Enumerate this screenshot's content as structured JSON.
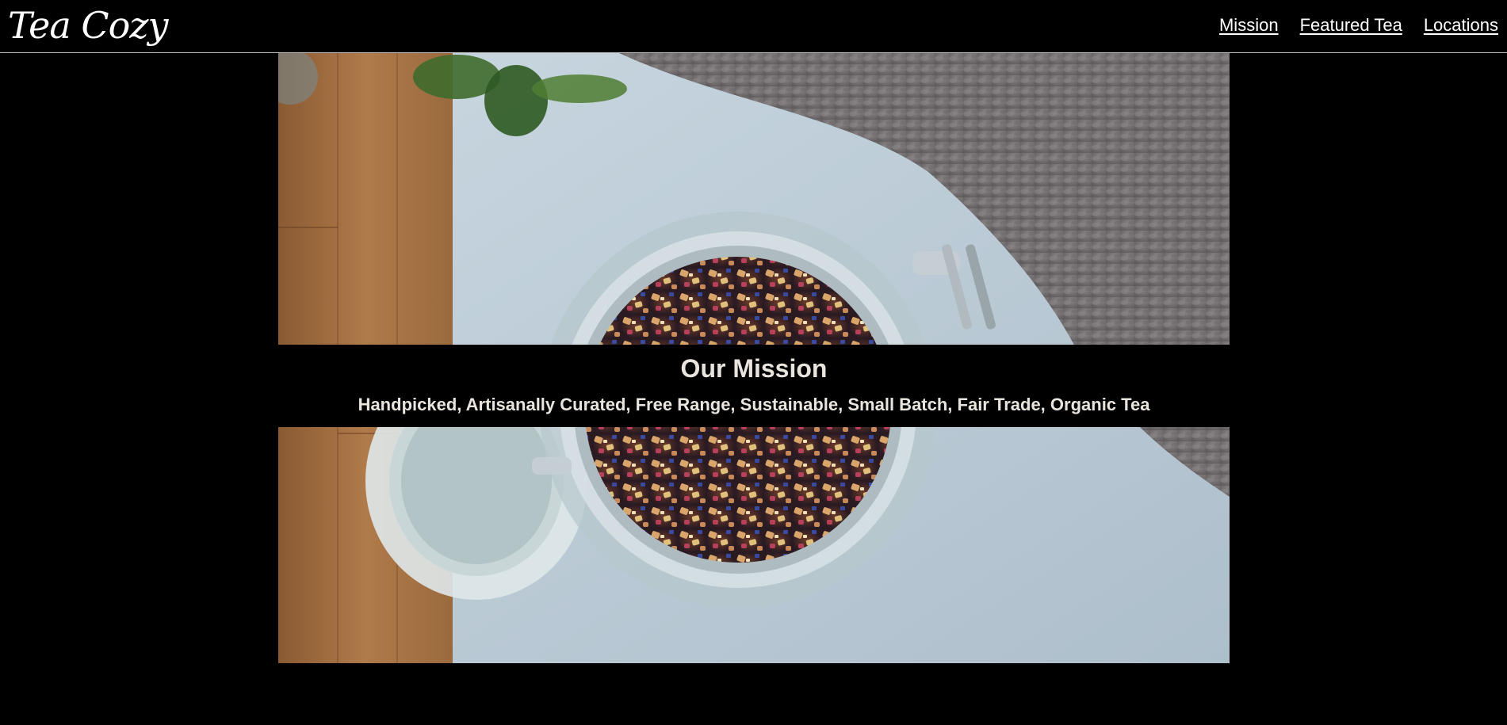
{
  "header": {
    "logo": "Tea Cozy",
    "nav": [
      {
        "label": "Mission"
      },
      {
        "label": "Featured Tea"
      },
      {
        "label": "Locations"
      }
    ]
  },
  "mission": {
    "title": "Our Mission",
    "subtitle": "Handpicked, Artisanally Curated, Free Range, Sustainable, Small Batch, Fair Trade, Organic Tea"
  },
  "colors": {
    "page_background": "#000000",
    "text_light": "#e9e4de",
    "link": "#ffffff",
    "header_border": "#bdbdbd"
  },
  "icons": {
    "hero_image": "open-glass-jar-of-loose-leaf-tea-photo"
  }
}
